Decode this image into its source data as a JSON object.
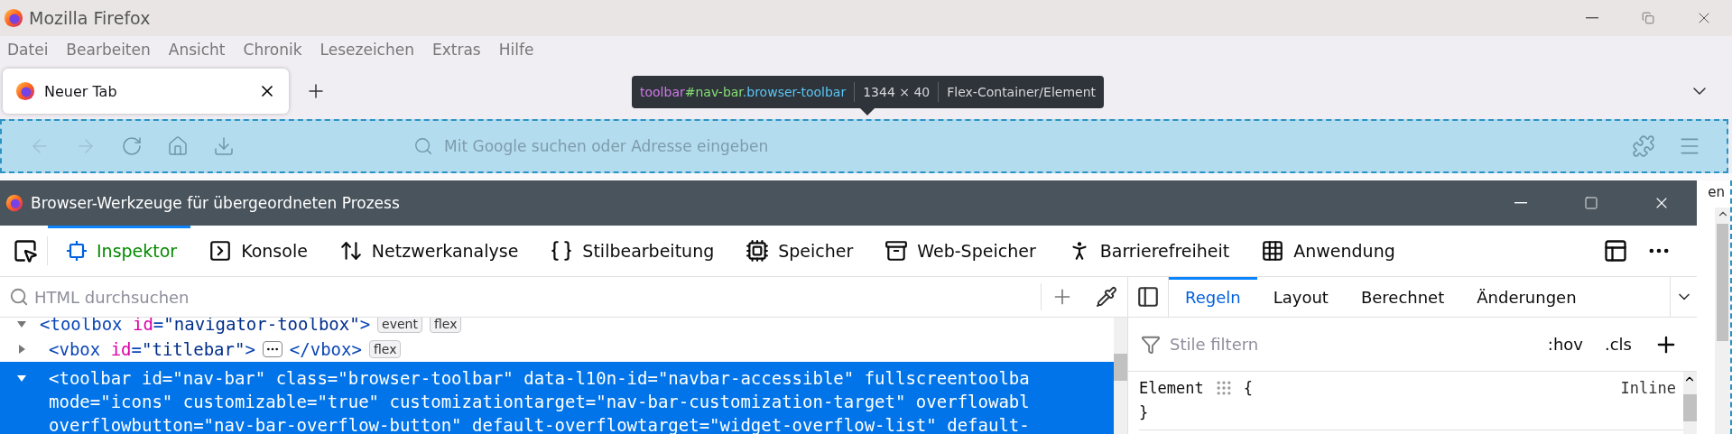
{
  "browser_window": {
    "title": "Mozilla Firefox"
  },
  "menu_bar": [
    "Datei",
    "Bearbeiten",
    "Ansicht",
    "Chronik",
    "Lesezeichen",
    "Extras",
    "Hilfe"
  ],
  "tabs": [
    {
      "label": "Neuer Tab",
      "selected": true
    }
  ],
  "highlight_tooltip": {
    "selector": [
      {
        "kind": "tag",
        "text": "toolbar"
      },
      {
        "kind": "id",
        "text": "#nav-bar"
      },
      {
        "kind": "class",
        "text": ".browser-toolbar"
      }
    ],
    "size": "1344 × 40",
    "type": "Flex-Container/Element"
  },
  "nav_bar": {
    "placeholder": "Mit Google suchen oder Adresse eingeben"
  },
  "devtools": {
    "title": "Browser-Werkzeuge für übergeordneten Prozess",
    "tools": [
      {
        "label": "Inspektor",
        "selected": true
      },
      {
        "label": "Konsole",
        "selected": false
      },
      {
        "label": "Netzwerkanalyse",
        "selected": false
      },
      {
        "label": "Stilbearbeitung",
        "selected": false
      },
      {
        "label": "Speicher",
        "selected": false
      },
      {
        "label": "Web-Speicher",
        "selected": false
      },
      {
        "label": "Barrierefreiheit",
        "selected": false
      },
      {
        "label": "Anwendung",
        "selected": false
      }
    ],
    "markup_search": {
      "placeholder": "HTML durchsuchen"
    },
    "markup": [
      {
        "expanded": true,
        "selected": false,
        "lines": [
          [
            {
              "kind": "code",
              "parts": [
                {
                  "kind": "punct",
                  "text": "<"
                },
                {
                  "kind": "tag",
                  "text": "toolbox"
                },
                {
                  "kind": "attr",
                  "text": " id"
                },
                {
                  "kind": "punct",
                  "text": "="
                },
                {
                  "kind": "value",
                  "text": "\"navigator-toolbox\""
                },
                {
                  "kind": "punct",
                  "text": ">"
                }
              ]
            },
            {
              "kind": "badge",
              "text": "event"
            },
            {
              "kind": "badge",
              "text": "flex"
            }
          ]
        ]
      },
      {
        "expanded": false,
        "selected": false,
        "lines": [
          [
            {
              "kind": "code",
              "parts": [
                {
                  "kind": "punct",
                  "text": "<"
                },
                {
                  "kind": "tag",
                  "text": "vbox"
                },
                {
                  "kind": "attr",
                  "text": " id"
                },
                {
                  "kind": "punct",
                  "text": "="
                },
                {
                  "kind": "value",
                  "text": "\"titlebar\""
                },
                {
                  "kind": "punct",
                  "text": ">"
                }
              ]
            },
            {
              "kind": "ellipsis"
            },
            {
              "kind": "code",
              "parts": [
                {
                  "kind": "punct",
                  "text": "</"
                },
                {
                  "kind": "tag",
                  "text": "vbox"
                },
                {
                  "kind": "punct",
                  "text": ">"
                }
              ]
            },
            {
              "kind": "badge",
              "text": "flex"
            }
          ]
        ]
      },
      {
        "expanded": true,
        "selected": true,
        "lines": [
          [
            {
              "kind": "text",
              "text": "<toolbar id=\"nav-bar\" class=\"browser-toolbar\" data-l10n-id=\"navbar-accessible\" fullscreentoolba"
            }
          ],
          [
            {
              "kind": "text",
              "text": "mode=\"icons\" customizable=\"true\" customizationtarget=\"nav-bar-customization-target\" overflowabl"
            }
          ],
          [
            {
              "kind": "text",
              "text": "overflowbutton=\"nav-bar-overflow-button\" default-overflowtarget=\"widget-overflow-list\" default-"
            }
          ]
        ]
      }
    ],
    "sidebar_tabs": [
      {
        "label": "Regeln",
        "selected": true
      },
      {
        "label": "Layout",
        "selected": false
      },
      {
        "label": "Berechnet",
        "selected": false
      },
      {
        "label": "Änderungen",
        "selected": false
      }
    ],
    "rules_filter": {
      "placeholder": "Stile filtern"
    },
    "rules_buttons": [
      ":hov",
      ".cls"
    ],
    "rules": [
      {
        "selector": "Element",
        "open": "{",
        "source": "Inline",
        "close": "}"
      }
    ]
  },
  "page_behind": {
    "text": "en"
  }
}
